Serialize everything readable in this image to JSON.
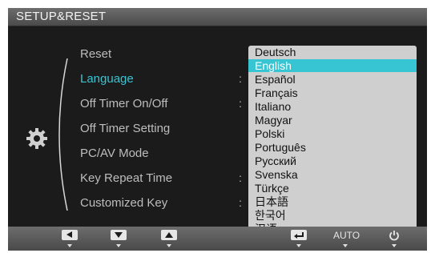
{
  "window": {
    "title": "SETUP&RESET"
  },
  "menu": {
    "items": [
      {
        "label": "Reset",
        "has_colon": false
      },
      {
        "label": "Language",
        "has_colon": true,
        "selected": true
      },
      {
        "label": "Off Timer On/Off",
        "has_colon": true
      },
      {
        "label": "Off Timer Setting",
        "has_colon": false
      },
      {
        "label": "PC/AV Mode",
        "has_colon": false
      },
      {
        "label": "Key Repeat Time",
        "has_colon": true
      },
      {
        "label": "Customized Key",
        "has_colon": true
      }
    ],
    "colon": ":"
  },
  "language_dropdown": {
    "options": [
      "Deutsch",
      "English",
      "Español",
      "Français",
      "Italiano",
      "Magyar",
      "Polski",
      "Português",
      "Русский",
      "Svenska",
      "Türkçe",
      "日本語",
      "한국어",
      "汉语"
    ],
    "selected": "English"
  },
  "buttons": {
    "auto_label": "AUTO",
    "icons": [
      "left-arrow-icon",
      "down-arrow-icon",
      "up-arrow-icon",
      "enter-icon",
      "auto-button",
      "power-icon"
    ]
  },
  "colors": {
    "accent": "#37c5d3",
    "menu_text": "#bdbdbd",
    "background": "#1b1b1b",
    "dropdown_bg": "#cfcfcf"
  }
}
